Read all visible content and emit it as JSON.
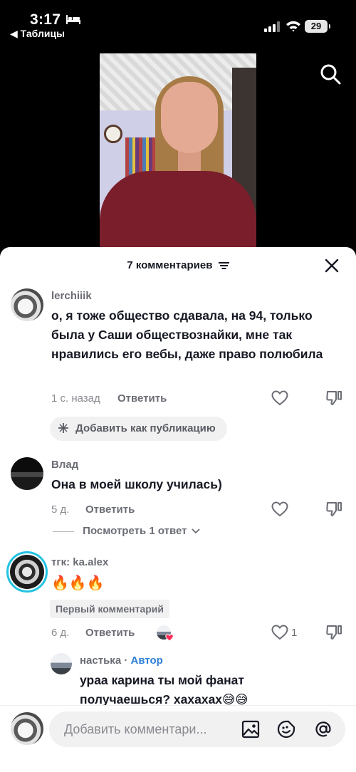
{
  "status_bar": {
    "time": "3:17",
    "back_label": "◀ Таблицы",
    "battery": "29"
  },
  "video": {
    "icons": [
      "search-icon"
    ]
  },
  "comments_sheet": {
    "title": "7 комментариев",
    "comments": [
      {
        "username": "lerchiiik",
        "text": "о, я тоже общество сдавала, на 94, только была у Саши обществознайки, мне так нравились его вебы, даже право полюбила",
        "time": "1 с. назад",
        "reply_label": "Ответить",
        "add_as_post_label": "Добавить как публикацию"
      },
      {
        "username": "Влад",
        "text": "Она в моей школу училась)",
        "time": "5 д.",
        "reply_label": "Ответить",
        "view_replies_label": "Посмотреть 1 ответ"
      },
      {
        "username": "тгк: ka.alex",
        "text": "🔥🔥🔥",
        "badge": "Первый комментарий",
        "time": "6 д.",
        "reply_label": "Ответить",
        "likes": "1"
      },
      {
        "username": "настька",
        "separator": " · ",
        "author_label": "Автор",
        "text": "ураа карина ты мой фанат получаешься? хахахах😅😅"
      }
    ]
  },
  "input": {
    "placeholder": "Добавить комментари..."
  },
  "colors": {
    "accent_blue": "#2e7fd6",
    "story_ring": "#23c2e2",
    "like_heart_red": "#fe2c55"
  }
}
